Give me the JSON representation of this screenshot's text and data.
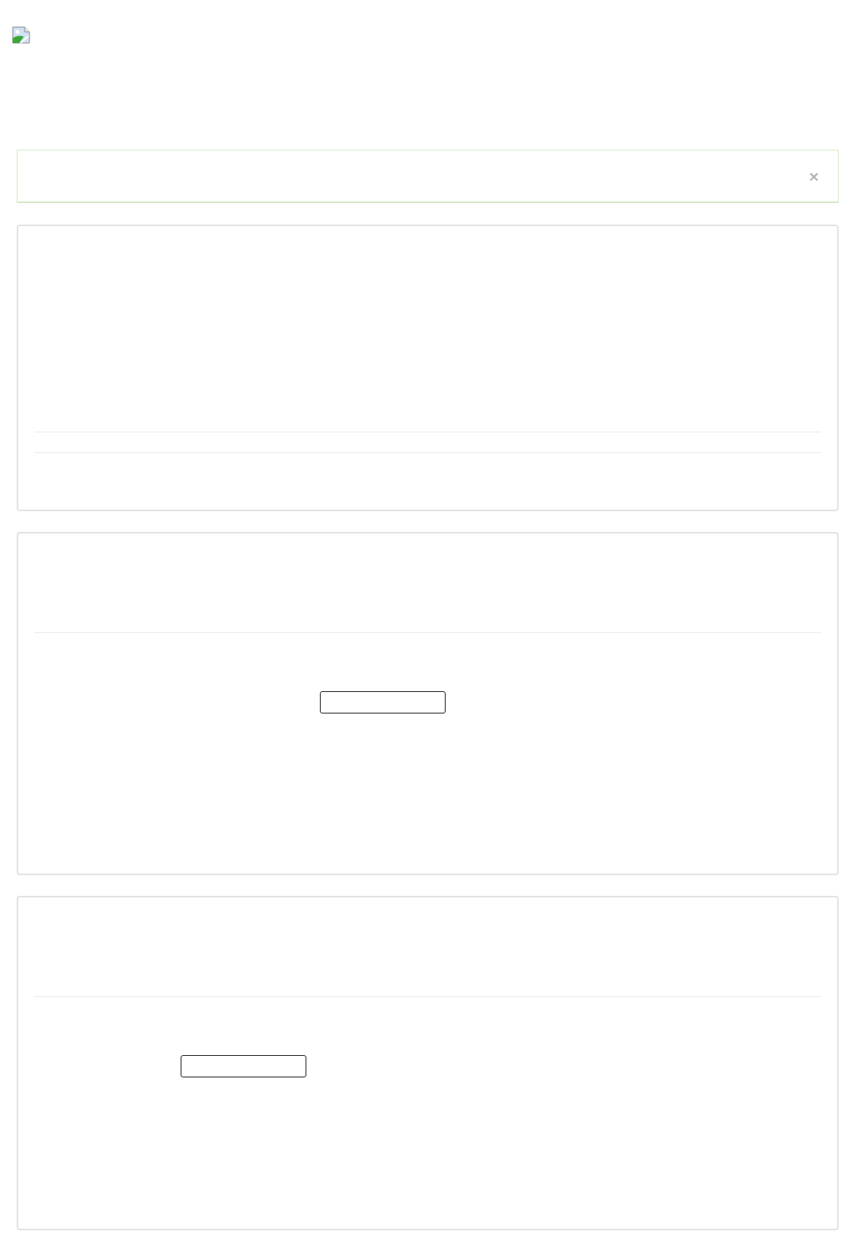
{
  "alert": {
    "close": "×"
  },
  "panels": [
    {
      "kind": "divided"
    },
    {
      "kind": "form"
    },
    {
      "kind": "form"
    }
  ]
}
